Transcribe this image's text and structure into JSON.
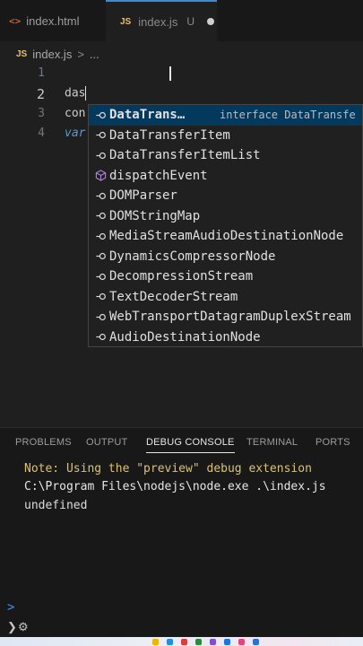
{
  "tabs": [
    {
      "icon": "html-icon",
      "label": "index.html"
    },
    {
      "icon": "js-icon",
      "label": "index.js",
      "status": "U"
    }
  ],
  "breadcrumb": {
    "file": "index.js",
    "separator": ">",
    "more": "..."
  },
  "editor": {
    "lines": [
      {
        "number": "1",
        "text": ""
      },
      {
        "number": "2",
        "text": "das"
      },
      {
        "number": "3",
        "text": "con"
      },
      {
        "number": "4",
        "text": "var"
      }
    ]
  },
  "suggestions": {
    "items": [
      {
        "label": "DataTrans…",
        "detail": "interface DataTransfe",
        "kind": "interface-icon"
      },
      {
        "label": "DataTransferItem",
        "kind": "interface-icon"
      },
      {
        "label": "DataTransferItemList",
        "kind": "interface-icon"
      },
      {
        "label": "dispatchEvent",
        "kind": "method-cube-icon"
      },
      {
        "label": "DOMParser",
        "kind": "interface-icon"
      },
      {
        "label": "DOMStringMap",
        "kind": "interface-icon"
      },
      {
        "label": "MediaStreamAudioDestinationNode",
        "kind": "interface-icon"
      },
      {
        "label": "DynamicsCompressorNode",
        "kind": "interface-icon"
      },
      {
        "label": "DecompressionStream",
        "kind": "interface-icon"
      },
      {
        "label": "TextDecoderStream",
        "kind": "interface-icon"
      },
      {
        "label": "WebTransportDatagramDuplexStream",
        "kind": "interface-icon"
      },
      {
        "label": "AudioDestinationNode",
        "kind": "interface-icon"
      }
    ]
  },
  "panel": {
    "tabs": [
      "PROBLEMS",
      "OUTPUT",
      "DEBUG CONSOLE",
      "TERMINAL",
      "PORTS"
    ],
    "active_tab": "DEBUG CONSOLE",
    "console": {
      "note": "Note: Using the \"preview\" debug extension",
      "command": "C:\\Program Files\\nodejs\\node.exe .\\index.js",
      "output": "undefined"
    },
    "prompt": ">"
  },
  "colors": {
    "accent": "#3c8ad8",
    "selection": "#04395e",
    "note": "#dcc26f"
  }
}
